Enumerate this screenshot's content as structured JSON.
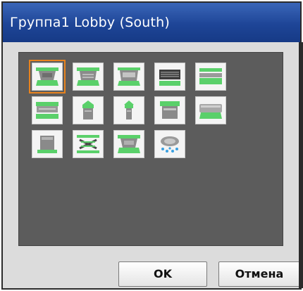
{
  "window": {
    "title": "Группа1  Lobby (South)"
  },
  "units": [
    {
      "icon": "4-way-cassette-icon",
      "selected": true
    },
    {
      "icon": "4-way-cassette-flat-icon",
      "selected": false
    },
    {
      "icon": "2-way-cassette-icon",
      "selected": false
    },
    {
      "icon": "ceiling-concealed-duct-icon",
      "selected": false
    },
    {
      "icon": "ceiling-suspended-icon",
      "selected": false
    },
    {
      "icon": "1-way-cassette-icon",
      "selected": false
    },
    {
      "icon": "floor-standing-icon",
      "selected": false
    },
    {
      "icon": "floor-standing-slim-icon",
      "selected": false
    },
    {
      "icon": "floor-concealed-icon",
      "selected": false
    },
    {
      "icon": "wall-mounted-icon",
      "selected": false
    },
    {
      "icon": "air-handling-unit-icon",
      "selected": false
    },
    {
      "icon": "heat-recovery-ventilator-icon",
      "selected": false
    },
    {
      "icon": "round-flow-cassette-icon",
      "selected": false
    },
    {
      "icon": "round-diffuser-icon",
      "selected": false
    }
  ],
  "buttons": {
    "ok_label": "OK",
    "cancel_label": "Отмена"
  },
  "colors": {
    "title_bar": "#1e4597",
    "panel": "#5c5c5c",
    "selection": "#e8831e",
    "airflow": "#5ad06a"
  }
}
